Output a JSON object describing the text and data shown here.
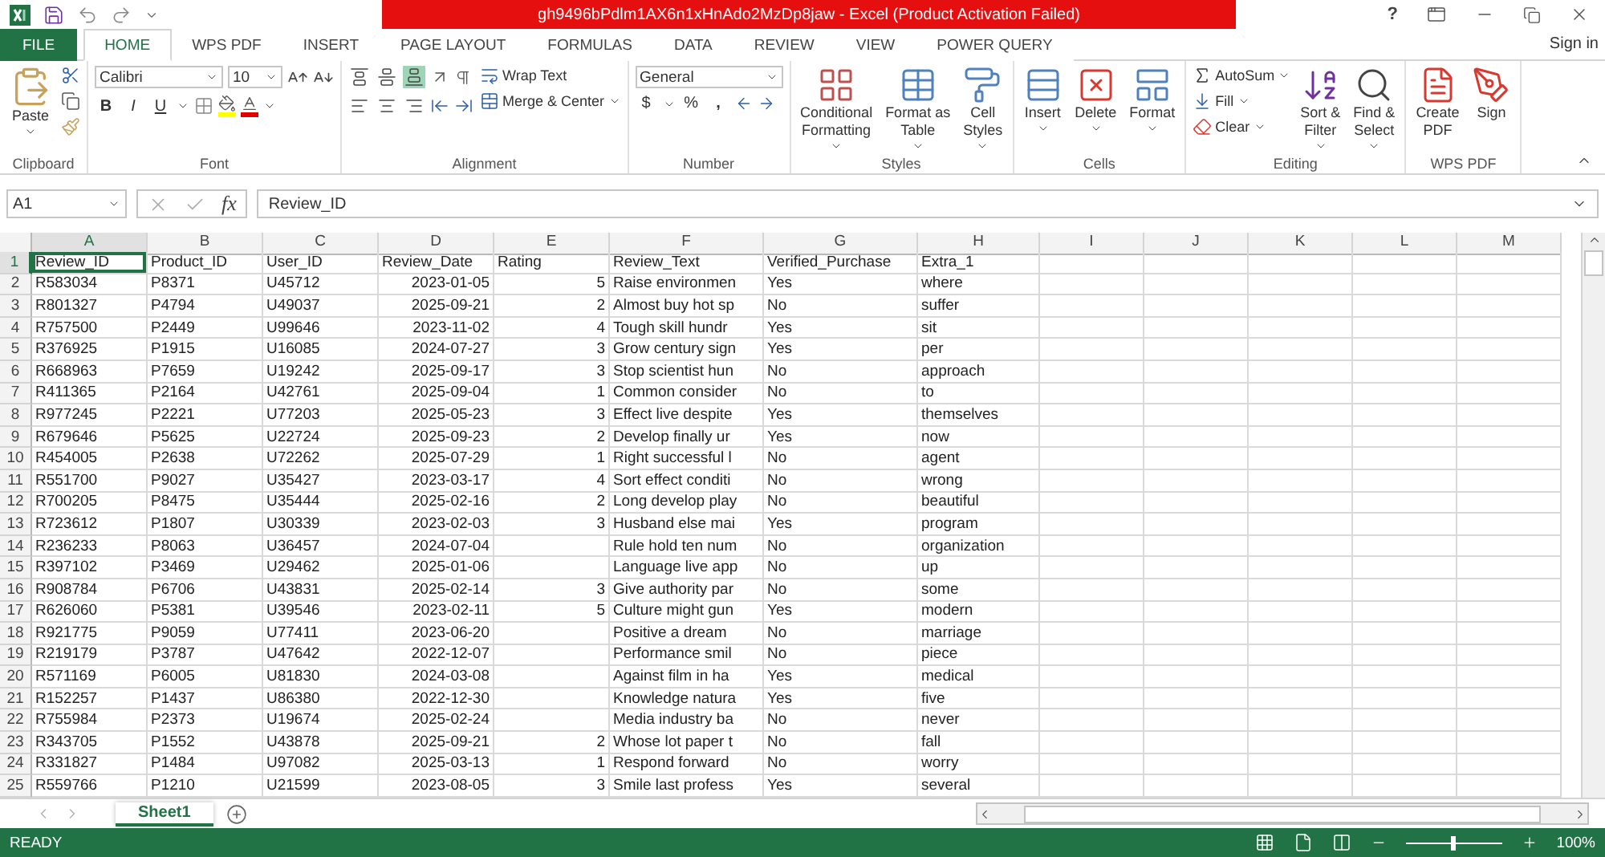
{
  "title_bar": {
    "title": "gh9496bPdlm1AX6n1xHnAdo2MzDp8jaw - Excel (Product Activation Failed)",
    "help": "?"
  },
  "tabs": [
    {
      "label": "FILE",
      "kind": "file",
      "selected": false
    },
    {
      "label": "HOME",
      "kind": "tab",
      "selected": true
    },
    {
      "label": "WPS PDF",
      "kind": "tab",
      "selected": false
    },
    {
      "label": "INSERT",
      "kind": "tab",
      "selected": false
    },
    {
      "label": "PAGE LAYOUT",
      "kind": "tab",
      "selected": false
    },
    {
      "label": "FORMULAS",
      "kind": "tab",
      "selected": false
    },
    {
      "label": "DATA",
      "kind": "tab",
      "selected": false
    },
    {
      "label": "REVIEW",
      "kind": "tab",
      "selected": false
    },
    {
      "label": "VIEW",
      "kind": "tab",
      "selected": false
    },
    {
      "label": "POWER QUERY",
      "kind": "tab",
      "selected": false
    }
  ],
  "sign_in": "Sign in",
  "ribbon": {
    "clipboard": {
      "paste": "Paste",
      "label": "Clipboard"
    },
    "font": {
      "name": "Calibri",
      "size": "10",
      "bold": "B",
      "italic": "I",
      "underline": "U",
      "label": "Font"
    },
    "alignment": {
      "vertical": [
        {
          "kind": "top",
          "selected": false
        },
        {
          "kind": "middle",
          "selected": false
        },
        {
          "kind": "bottom",
          "selected": true
        }
      ],
      "horizontal": [
        {
          "kind": "left",
          "selected": false
        },
        {
          "kind": "center",
          "selected": false
        },
        {
          "kind": "right",
          "selected": false
        }
      ],
      "wrap_text": "Wrap Text",
      "merge": "Merge & Center",
      "label": "Alignment"
    },
    "number": {
      "format": "General",
      "currency": "$",
      "percent": "%",
      "comma": ",",
      "label": "Number"
    },
    "styles": {
      "buttons": [
        {
          "kind": "conditional",
          "lines": [
            "Conditional",
            "Formatting"
          ],
          "dropdown": true
        },
        {
          "kind": "table",
          "lines": [
            "Format as",
            "Table"
          ],
          "dropdown": true
        },
        {
          "kind": "cell",
          "lines": [
            "Cell",
            "Styles"
          ],
          "dropdown": true
        }
      ],
      "label": "Styles"
    },
    "cells": {
      "buttons": [
        {
          "kind": "insert",
          "lines": [
            "Insert"
          ],
          "dropdown": true
        },
        {
          "kind": "delete",
          "lines": [
            "Delete"
          ],
          "dropdown": true
        },
        {
          "kind": "format",
          "lines": [
            "Format"
          ],
          "dropdown": true
        }
      ],
      "label": "Cells"
    },
    "editing": {
      "autosum": "AutoSum",
      "fill": "Fill",
      "clear": "Clear",
      "buttons": [
        {
          "kind": "sort",
          "lines": [
            "Sort &",
            "Filter"
          ],
          "dropdown": true
        },
        {
          "kind": "find",
          "lines": [
            "Find &",
            "Select"
          ],
          "dropdown": true
        }
      ],
      "label": "Editing"
    },
    "wps_pdf": {
      "buttons": [
        {
          "kind": "create",
          "lines": [
            "Create",
            "PDF"
          ],
          "dropdown": false
        },
        {
          "kind": "sign",
          "lines": [
            "Sign"
          ],
          "dropdown": false
        }
      ],
      "label": "WPS PDF"
    }
  },
  "formula_bar": {
    "name_box": "A1",
    "fx": "fx",
    "value": "Review_ID"
  },
  "grid": {
    "columns": [
      {
        "letter": "A",
        "selected": true,
        "numeric": false
      },
      {
        "letter": "B",
        "selected": false,
        "numeric": false
      },
      {
        "letter": "C",
        "selected": false,
        "numeric": false
      },
      {
        "letter": "D",
        "selected": false,
        "numeric": true
      },
      {
        "letter": "E",
        "selected": false,
        "numeric": true
      },
      {
        "letter": "F",
        "selected": false,
        "numeric": false
      },
      {
        "letter": "G",
        "selected": false,
        "numeric": false
      },
      {
        "letter": "H",
        "selected": false,
        "numeric": false
      },
      {
        "letter": "I",
        "selected": false,
        "numeric": false
      },
      {
        "letter": "J",
        "selected": false,
        "numeric": false
      },
      {
        "letter": "K",
        "selected": false,
        "numeric": false
      },
      {
        "letter": "L",
        "selected": false,
        "numeric": false
      },
      {
        "letter": "M",
        "selected": false,
        "numeric": false
      }
    ],
    "rows": [
      {
        "number": "1",
        "selected": true,
        "kind": "header",
        "cells": {
          "A": "Review_ID",
          "B": "Product_ID",
          "C": "User_ID",
          "D": "Review_Date",
          "E": "Rating",
          "F": "Review_Text",
          "G": "Verified_Purchase",
          "H": "Extra_1"
        }
      },
      {
        "number": "2",
        "selected": false,
        "kind": "data",
        "cells": {
          "A": "R583034",
          "B": "P8371",
          "C": "U45712",
          "D": "2023-01-05",
          "E": "5",
          "F": "Raise environmen",
          "G": "Yes",
          "H": "where"
        }
      },
      {
        "number": "3",
        "selected": false,
        "kind": "data",
        "cells": {
          "A": "R801327",
          "B": "P4794",
          "C": "U49037",
          "D": "2025-09-21",
          "E": "2",
          "F": "Almost buy hot sp",
          "G": "No",
          "H": "suffer"
        }
      },
      {
        "number": "4",
        "selected": false,
        "kind": "data",
        "cells": {
          "A": "R757500",
          "B": "P2449",
          "C": "U99646",
          "D": "2023-11-02",
          "E": "4",
          "F": "Tough skill hundr",
          "G": "Yes",
          "H": "sit"
        }
      },
      {
        "number": "5",
        "selected": false,
        "kind": "data",
        "cells": {
          "A": "R376925",
          "B": "P1915",
          "C": "U16085",
          "D": "2024-07-27",
          "E": "3",
          "F": "Grow century sign",
          "G": "Yes",
          "H": "per"
        }
      },
      {
        "number": "6",
        "selected": false,
        "kind": "data",
        "cells": {
          "A": "R668963",
          "B": "P7659",
          "C": "U19242",
          "D": "2025-09-17",
          "E": "3",
          "F": "Stop scientist hun",
          "G": "No",
          "H": "approach"
        }
      },
      {
        "number": "7",
        "selected": false,
        "kind": "data",
        "cells": {
          "A": "R411365",
          "B": "P2164",
          "C": "U42761",
          "D": "2025-09-04",
          "E": "1",
          "F": "Common consider",
          "G": "No",
          "H": "to"
        }
      },
      {
        "number": "8",
        "selected": false,
        "kind": "data",
        "cells": {
          "A": "R977245",
          "B": "P2221",
          "C": "U77203",
          "D": "2025-05-23",
          "E": "3",
          "F": "Effect live despite",
          "G": "Yes",
          "H": "themselves"
        }
      },
      {
        "number": "9",
        "selected": false,
        "kind": "data",
        "cells": {
          "A": "R679646",
          "B": "P5625",
          "C": "U22724",
          "D": "2025-09-23",
          "E": "2",
          "F": "Develop finally ur",
          "G": "Yes",
          "H": "now"
        }
      },
      {
        "number": "10",
        "selected": false,
        "kind": "data",
        "cells": {
          "A": "R454005",
          "B": "P2638",
          "C": "U72262",
          "D": "2025-07-29",
          "E": "1",
          "F": "Right successful l",
          "G": "No",
          "H": "agent"
        }
      },
      {
        "number": "11",
        "selected": false,
        "kind": "data",
        "cells": {
          "A": "R551700",
          "B": "P9027",
          "C": "U35427",
          "D": "2023-03-17",
          "E": "4",
          "F": "Sort effect conditi",
          "G": "No",
          "H": "wrong"
        }
      },
      {
        "number": "12",
        "selected": false,
        "kind": "data",
        "cells": {
          "A": "R700205",
          "B": "P8475",
          "C": "U35444",
          "D": "2025-02-16",
          "E": "2",
          "F": "Long develop play",
          "G": "No",
          "H": "beautiful"
        }
      },
      {
        "number": "13",
        "selected": false,
        "kind": "data",
        "cells": {
          "A": "R723612",
          "B": "P1807",
          "C": "U30339",
          "D": "2023-02-03",
          "E": "3",
          "F": "Husband else mai",
          "G": "Yes",
          "H": "program"
        }
      },
      {
        "number": "14",
        "selected": false,
        "kind": "data",
        "cells": {
          "A": "R236233",
          "B": "P8063",
          "C": "U36457",
          "D": "2024-07-04",
          "F": "Rule hold ten num",
          "G": "No",
          "H": "organization"
        }
      },
      {
        "number": "15",
        "selected": false,
        "kind": "data",
        "cells": {
          "A": "R397102",
          "B": "P3469",
          "C": "U29462",
          "D": "2025-01-06",
          "F": "Language live app",
          "G": "No",
          "H": "up"
        }
      },
      {
        "number": "16",
        "selected": false,
        "kind": "data",
        "cells": {
          "A": "R908784",
          "B": "P6706",
          "C": "U43831",
          "D": "2025-02-14",
          "E": "3",
          "F": "Give authority par",
          "G": "No",
          "H": "some"
        }
      },
      {
        "number": "17",
        "selected": false,
        "kind": "data",
        "cells": {
          "A": "R626060",
          "B": "P5381",
          "C": "U39546",
          "D": "2023-02-11",
          "E": "5",
          "F": "Culture might gun",
          "G": "Yes",
          "H": "modern"
        }
      },
      {
        "number": "18",
        "selected": false,
        "kind": "data",
        "cells": {
          "A": "R921775",
          "B": "P9059",
          "C": "U77411",
          "D": "2023-06-20",
          "F": "Positive a dream",
          "G": "No",
          "H": "marriage"
        }
      },
      {
        "number": "19",
        "selected": false,
        "kind": "data",
        "cells": {
          "A": "R219179",
          "B": "P3787",
          "C": "U47642",
          "D": "2022-12-07",
          "F": "Performance smil",
          "G": "No",
          "H": "piece"
        }
      },
      {
        "number": "20",
        "selected": false,
        "kind": "data",
        "cells": {
          "A": "R571169",
          "B": "P6005",
          "C": "U81830",
          "D": "2024-03-08",
          "F": "Against film in ha",
          "G": "Yes",
          "H": "medical"
        }
      },
      {
        "number": "21",
        "selected": false,
        "kind": "data",
        "cells": {
          "A": "R152257",
          "B": "P1437",
          "C": "U86380",
          "D": "2022-12-30",
          "F": "Knowledge natura",
          "G": "Yes",
          "H": "five"
        }
      },
      {
        "number": "22",
        "selected": false,
        "kind": "data",
        "cells": {
          "A": "R755984",
          "B": "P2373",
          "C": "U19674",
          "D": "2025-02-24",
          "F": "Media industry ba",
          "G": "No",
          "H": "never"
        }
      },
      {
        "number": "23",
        "selected": false,
        "kind": "data",
        "cells": {
          "A": "R343705",
          "B": "P1552",
          "C": "U43878",
          "D": "2025-09-21",
          "E": "2",
          "F": "Whose lot paper t",
          "G": "No",
          "H": "fall"
        }
      },
      {
        "number": "24",
        "selected": false,
        "kind": "data",
        "cells": {
          "A": "R331827",
          "B": "P1484",
          "C": "U97082",
          "D": "2025-03-13",
          "E": "1",
          "F": "Respond forward",
          "G": "No",
          "H": "worry"
        }
      },
      {
        "number": "25",
        "selected": false,
        "kind": "data",
        "cells": {
          "A": "R559766",
          "B": "P1210",
          "C": "U21599",
          "D": "2023-08-05",
          "E": "3",
          "F": "Smile last profess",
          "G": "Yes",
          "H": "several"
        }
      }
    ]
  },
  "sheets": [
    {
      "name": "Sheet1",
      "selected": true
    }
  ],
  "status_bar": {
    "status": "READY",
    "zoom": {
      "level": 0.5,
      "reading": "100%"
    }
  }
}
